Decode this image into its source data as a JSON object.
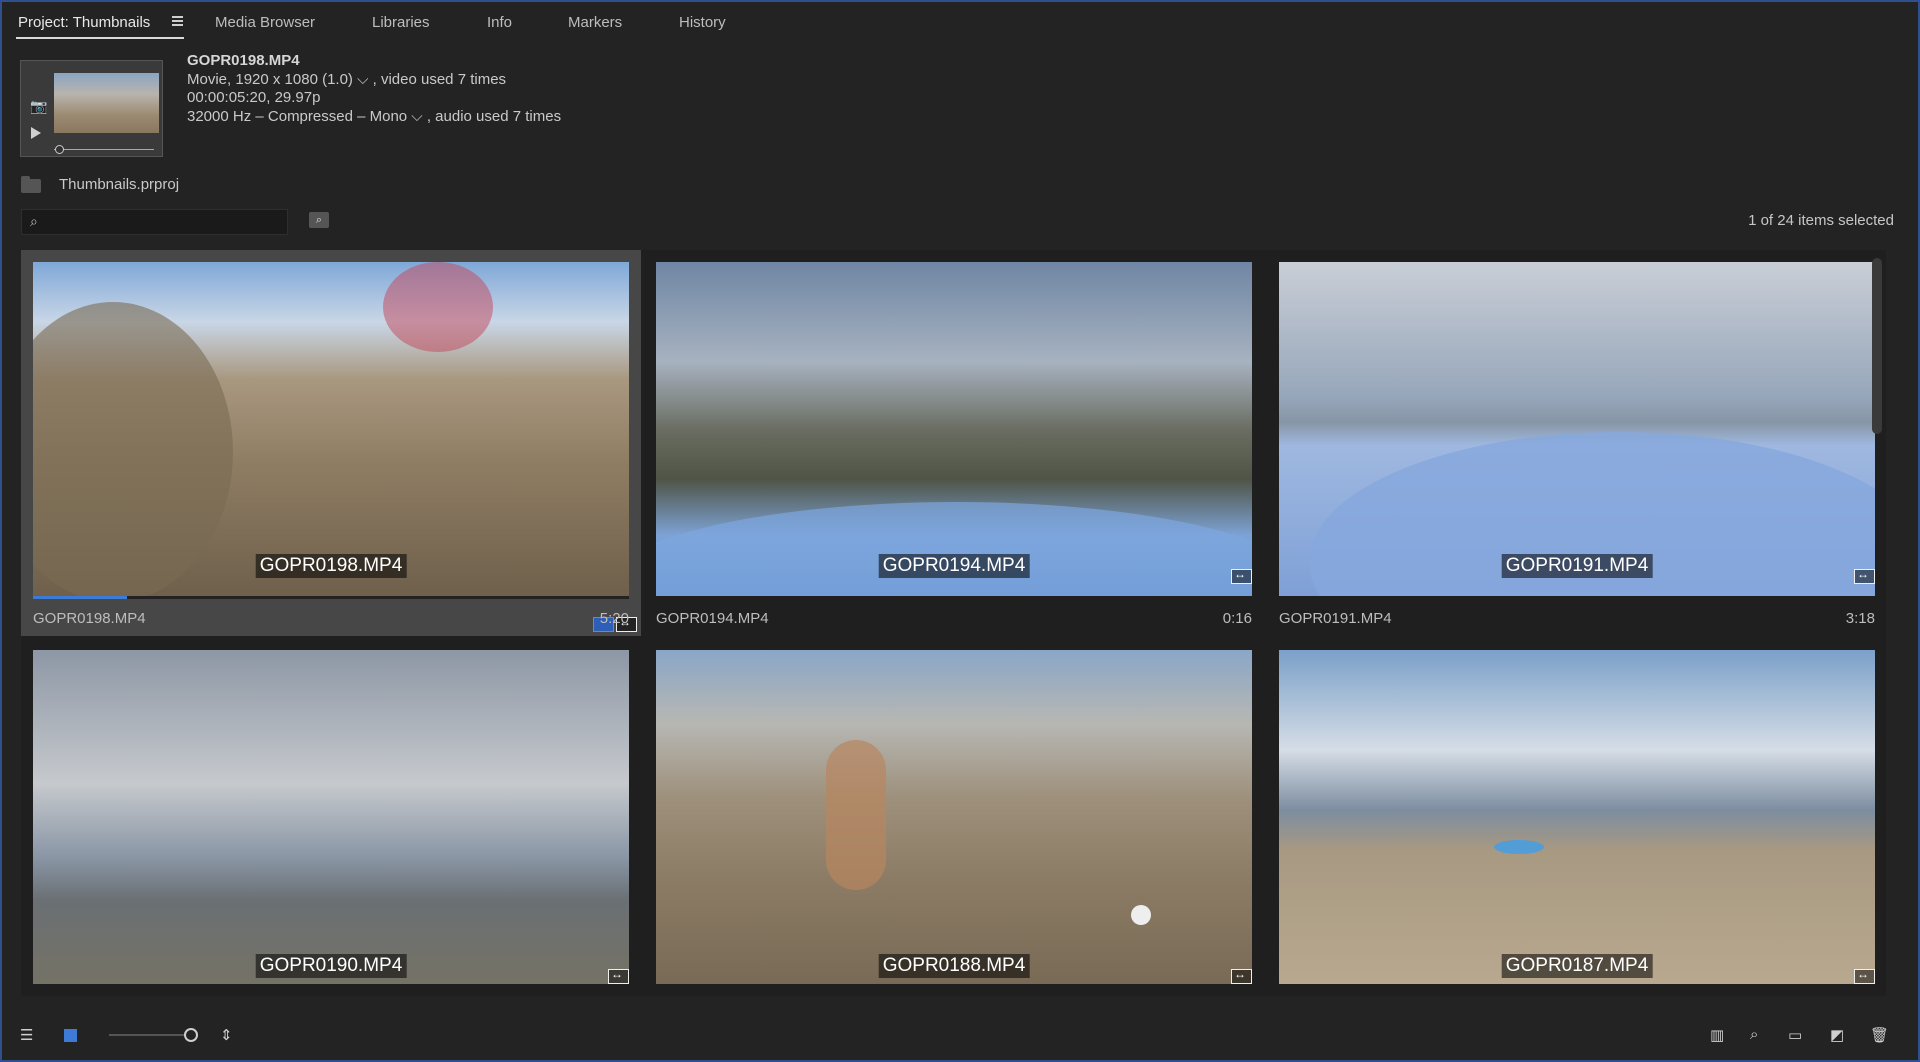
{
  "tabs": {
    "project": "Project: Thumbnails",
    "media_browser": "Media Browser",
    "libraries": "Libraries",
    "info": "Info",
    "markers": "Markers",
    "history": "History"
  },
  "clip": {
    "name": "GOPR0198.MP4",
    "video_line": "Movie, 1920 x 1080 (1.0) ⌵ , video used 7 times",
    "timecode_line": "00:00:05:20, 29.97p",
    "audio_line": "32000 Hz – Compressed – Mono ⌵ , audio used 7 times"
  },
  "project": {
    "file": "Thumbnails.prproj",
    "selection": "1 of 24 items selected"
  },
  "search": {
    "value": "",
    "placeholder": ""
  },
  "items": [
    {
      "name": "GOPR0198.MP4",
      "duration": "5:20",
      "selected": true
    },
    {
      "name": "GOPR0194.MP4",
      "duration": "0:16",
      "selected": false
    },
    {
      "name": "GOPR0191.MP4",
      "duration": "3:18",
      "selected": false
    },
    {
      "name": "GOPR0190.MP4",
      "duration": "",
      "selected": false
    },
    {
      "name": "GOPR0188.MP4",
      "duration": "",
      "selected": false
    },
    {
      "name": "GOPR0187.MP4",
      "duration": "",
      "selected": false
    }
  ],
  "icons": {
    "list_view": "list-view-icon",
    "icon_view": "icon-view-icon",
    "zoom": "zoom-slider",
    "sort": "sort-icon",
    "automate": "automate-to-sequence-icon",
    "find": "find-icon",
    "new_bin": "new-bin-icon",
    "new_item": "new-item-icon",
    "clear": "trash-icon"
  },
  "colors": {
    "accent": "#3d7bd6",
    "frame": "#2f4f8f",
    "background": "#232323"
  }
}
